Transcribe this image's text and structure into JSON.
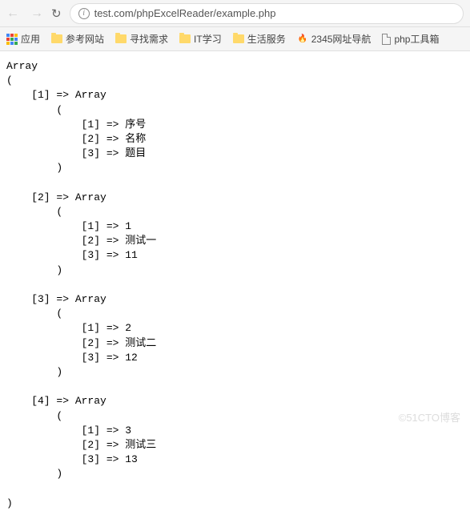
{
  "browser": {
    "url": "test.com/phpExcelReader/example.php",
    "apps_label": "应用"
  },
  "bookmarks": [
    {
      "type": "folder",
      "label": "参考网站"
    },
    {
      "type": "folder",
      "label": "寻找需求"
    },
    {
      "type": "folder",
      "label": "IT学习"
    },
    {
      "type": "folder",
      "label": "生活服务"
    },
    {
      "type": "site",
      "label": "2345网址导航"
    },
    {
      "type": "doc",
      "label": "php工具箱"
    }
  ],
  "php_output": {
    "root_label": "Array",
    "rows": [
      {
        "key": "1",
        "values": {
          "1": "序号",
          "2": "名称",
          "3": "题目"
        }
      },
      {
        "key": "2",
        "values": {
          "1": "1",
          "2": "测试一",
          "3": "11"
        }
      },
      {
        "key": "3",
        "values": {
          "1": "2",
          "2": "测试二",
          "3": "12"
        }
      },
      {
        "key": "4",
        "values": {
          "1": "3",
          "2": "测试三",
          "3": "13"
        }
      }
    ]
  },
  "watermark": "©51CTO博客"
}
